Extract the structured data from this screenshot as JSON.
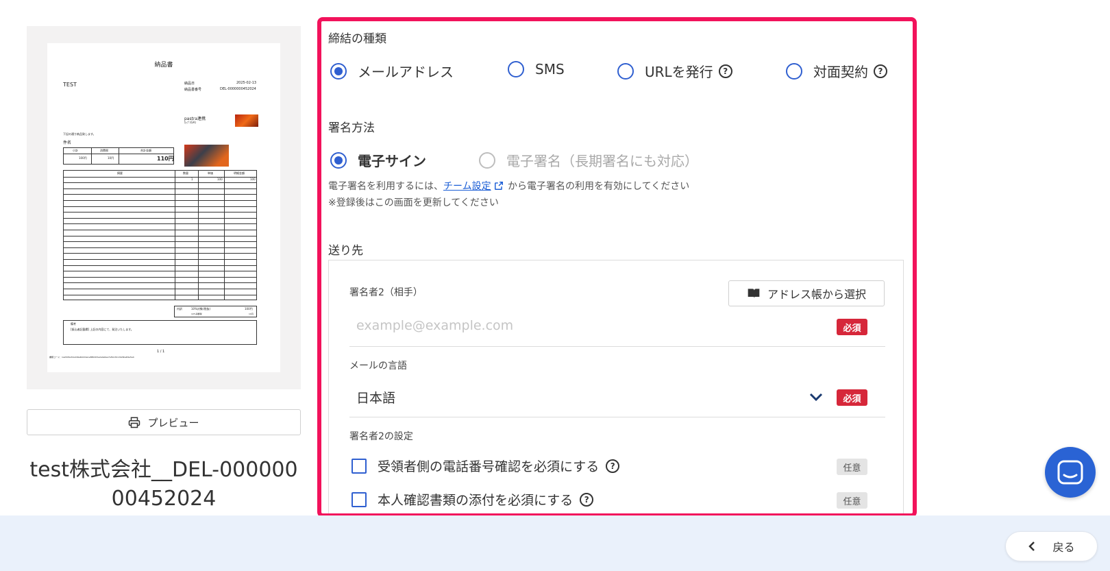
{
  "document_preview": {
    "title": "納品書",
    "client": "TEST",
    "meta": [
      {
        "label": "納品日",
        "value": "2025-02-13"
      },
      {
        "label": "納品書番号",
        "value": "DEL-0000000452024"
      }
    ],
    "company_name": "pastra連携",
    "company_sub": "ｶｯﾌﾟ(GA)",
    "intro": "下記の通り納品致します。",
    "subject_label": "件名",
    "summary_headers": [
      "小計",
      "消費税",
      "合計金額"
    ],
    "summary_values": [
      "100円",
      "10円",
      "110円"
    ],
    "table_headers": [
      "摘要",
      "数量",
      "単価",
      "明細金額"
    ],
    "first_row": [
      "",
      "1",
      "100",
      "100"
    ],
    "tax_label": "内訳",
    "tax_desc": "10%対象(税抜)",
    "tax_value": "100円",
    "tax_sub": "10%消費税",
    "tax_sub_value": "10円",
    "remarks_label": "備考",
    "remarks_text": "[振込者記載欄] 上記の内容にて、発注いたします。",
    "page_num": "1 / 1",
    "footer_code": "書類コード：1a2003e32a4d9e4b0d4e1e8802b5e2e0e6aa7a5b13dc2b29be84e5a4"
  },
  "preview_button": {
    "label": "プレビュー",
    "icon": "printer-icon"
  },
  "document_name": "test株式会社__DEL-00000000452024",
  "contract_type": {
    "label": "締結の種類",
    "options": [
      {
        "label": "メールアドレス",
        "selected": true
      },
      {
        "label": "SMS",
        "selected": false
      },
      {
        "label": "URLを発行",
        "selected": false,
        "help": "?"
      },
      {
        "label": "対面契約",
        "selected": false,
        "help": "?"
      }
    ]
  },
  "sign_method": {
    "label": "署名方法",
    "options": [
      {
        "label": "電子サイン",
        "selected": true
      },
      {
        "label": "電子署名（長期署名にも対応）",
        "selected": false,
        "disabled": true
      }
    ],
    "note_prefix": "電子署名を利用するには、",
    "note_link": "チーム設定",
    "note_suffix": " から電子署名の利用を有効にしてください",
    "note_line2": "※登録後はこの画面を更新してください"
  },
  "recipients": {
    "label": "送り先",
    "signer_label": "署名者2（相手）",
    "address_book_button": "アドレス帳から選択",
    "email_placeholder": "example@example.com",
    "required_badge": "必須",
    "language_label": "メールの言語",
    "language_value": "日本語",
    "settings_label": "署名者2の設定",
    "optional_badge": "任意",
    "settings": [
      {
        "label": "受領者側の電話番号確認を必須にする",
        "checked": false,
        "help": "?"
      },
      {
        "label": "本人確認書類の添付を必須にする",
        "checked": false,
        "help": "?"
      }
    ]
  },
  "footer": {
    "back_label": "戻る"
  },
  "colors": {
    "accent": "#2f5fd0",
    "highlight": "#f2125b",
    "required": "#d6273a",
    "footer_bg": "#eaf1fb"
  }
}
